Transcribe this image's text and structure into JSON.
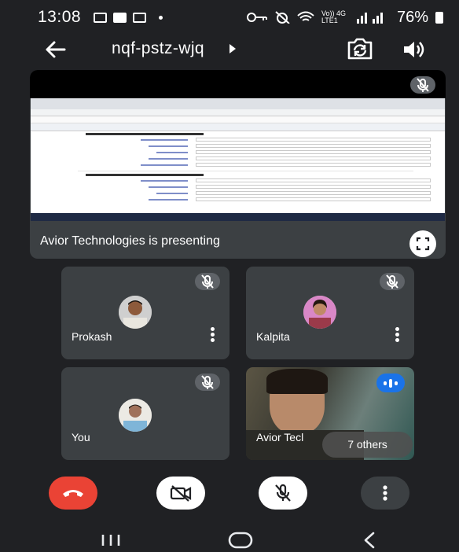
{
  "status_bar": {
    "time": "13:08",
    "network_label": "Vo)) 4G LTE1",
    "battery": "76%"
  },
  "meeting": {
    "code": "nqf-pstz-wjq"
  },
  "presentation": {
    "caption": "Avior Technologies is presenting"
  },
  "participants": [
    {
      "name": "Prokash",
      "muted": true
    },
    {
      "name": "Kalpita",
      "muted": true
    },
    {
      "name": "You",
      "muted": true
    },
    {
      "name": "Avior Tecl",
      "speaking": true
    }
  ],
  "others_label": "7 others",
  "controls": {
    "end_call": "end-call",
    "camera": "camera-off",
    "microphone": "mic-off",
    "more": "more-options"
  },
  "colors": {
    "background": "#202124",
    "tile": "#3c4043",
    "end_call": "#ea4335",
    "speaking": "#1a73e8"
  }
}
